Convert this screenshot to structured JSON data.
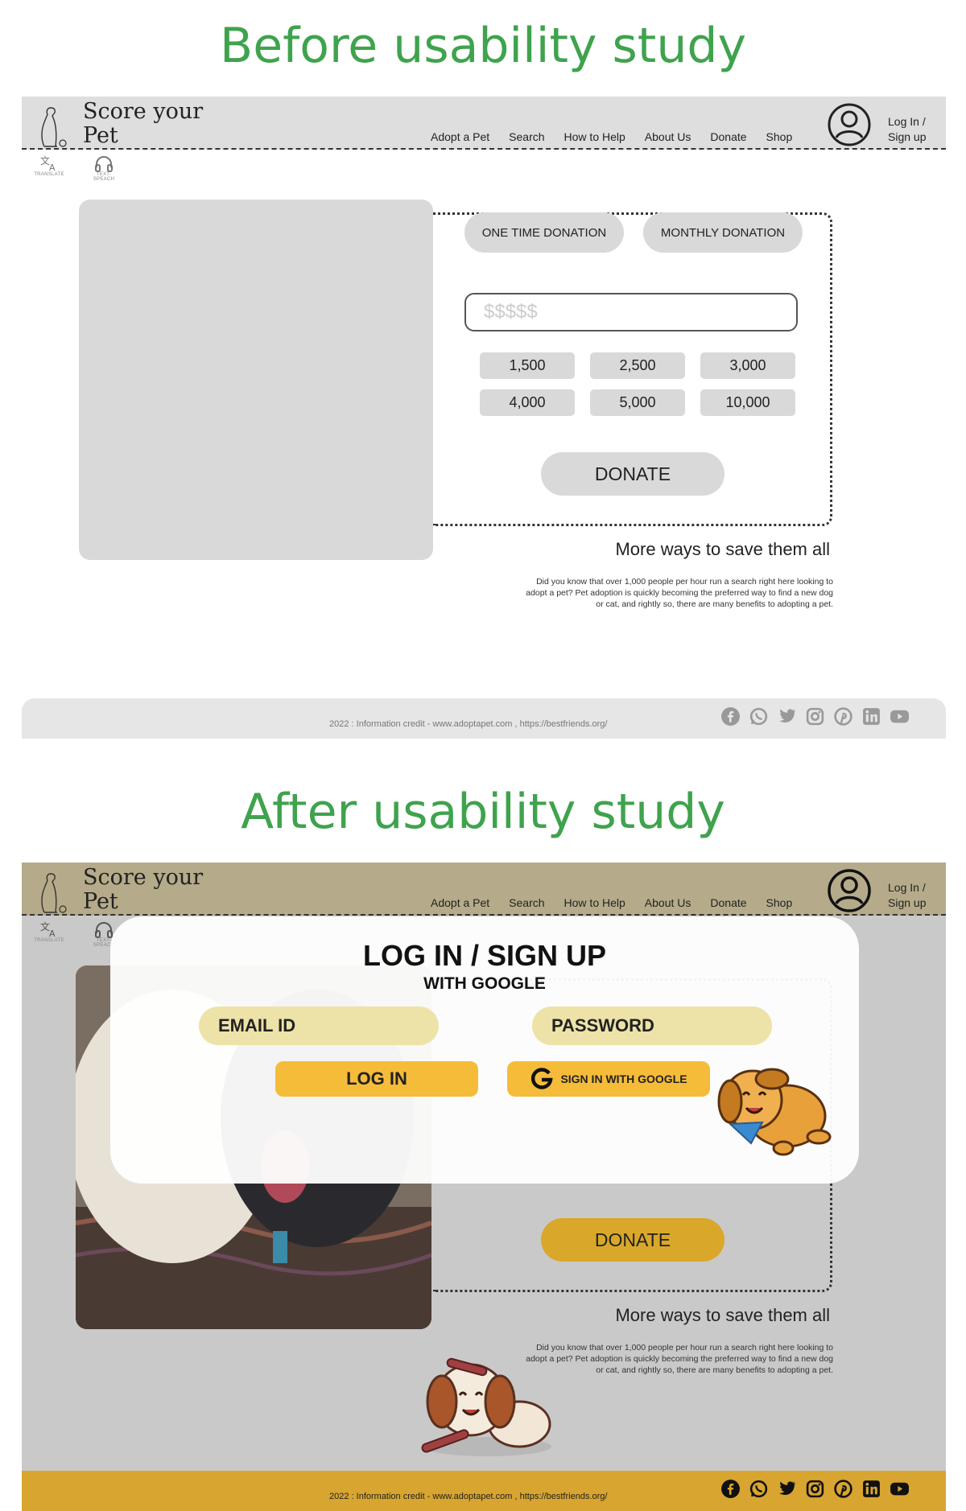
{
  "before": {
    "title": "Before usability study",
    "brand": {
      "line1": "Score your",
      "line2": "Pet"
    },
    "nav": [
      "Adopt a Pet",
      "Search",
      "How to Help",
      "About Us",
      "Donate",
      "Shop"
    ],
    "login": "Log In / Sign up",
    "tools": {
      "translate": "TRANSLATE",
      "speech": "TEXT-SPEACH"
    },
    "donation_types": [
      "ONE TIME DONATION",
      "MONTHLY DONATION"
    ],
    "amount_placeholder": "$$$$$",
    "presets": [
      "1,500",
      "2,500",
      "3,000",
      "4,000",
      "5,000",
      "10,000"
    ],
    "donate": "DONATE",
    "more_title": "More ways to save them all",
    "more_text": "Did you know that over 1,000 people per hour run a search right here looking to adopt a pet? Pet adoption is quickly becoming the preferred way to find a new dog or cat, and rightly so, there are many benefits to adopting a pet.",
    "footer": "2022 : Information credit - www.adoptapet.com , https://bestfriends.org/"
  },
  "after": {
    "title": "After usability study",
    "brand": {
      "line1": "Score your",
      "line2": "Pet"
    },
    "nav": [
      "Adopt a Pet",
      "Search",
      "How to Help",
      "About Us",
      "Donate",
      "Shop"
    ],
    "login": "Log In / Sign up",
    "tools": {
      "translate": "TRANSLATE",
      "speech": "TEXT-SPEACH"
    },
    "donate": "DONATE",
    "more_title": "More ways to save them all",
    "more_text": "Did you know that over 1,000 people per hour run a search right here looking to adopt a pet? Pet adoption is quickly becoming the preferred way to find a new dog or cat, and rightly so, there are many benefits to adopting a pet.",
    "footer": "2022 : Information credit - www.adoptapet.com , https://bestfriends.org/",
    "modal": {
      "title": "LOG IN / SIGN UP",
      "subtitle": "WITH GOOGLE",
      "email": "EMAIL ID",
      "password": "PASSWORD",
      "login_button": "LOG IN",
      "google_button": "SIGN IN WITH GOOGLE"
    }
  },
  "socials": [
    "facebook-icon",
    "whatsapp-icon",
    "twitter-icon",
    "instagram-icon",
    "pinterest-icon",
    "linkedin-icon",
    "youtube-icon"
  ],
  "colors": {
    "heading_green": "#3fa34d",
    "nav_after": "#b5ab8a",
    "accent_yellow": "#f5bc3a",
    "input_yellow": "#ede3a8",
    "footer_after": "#d8a530"
  }
}
